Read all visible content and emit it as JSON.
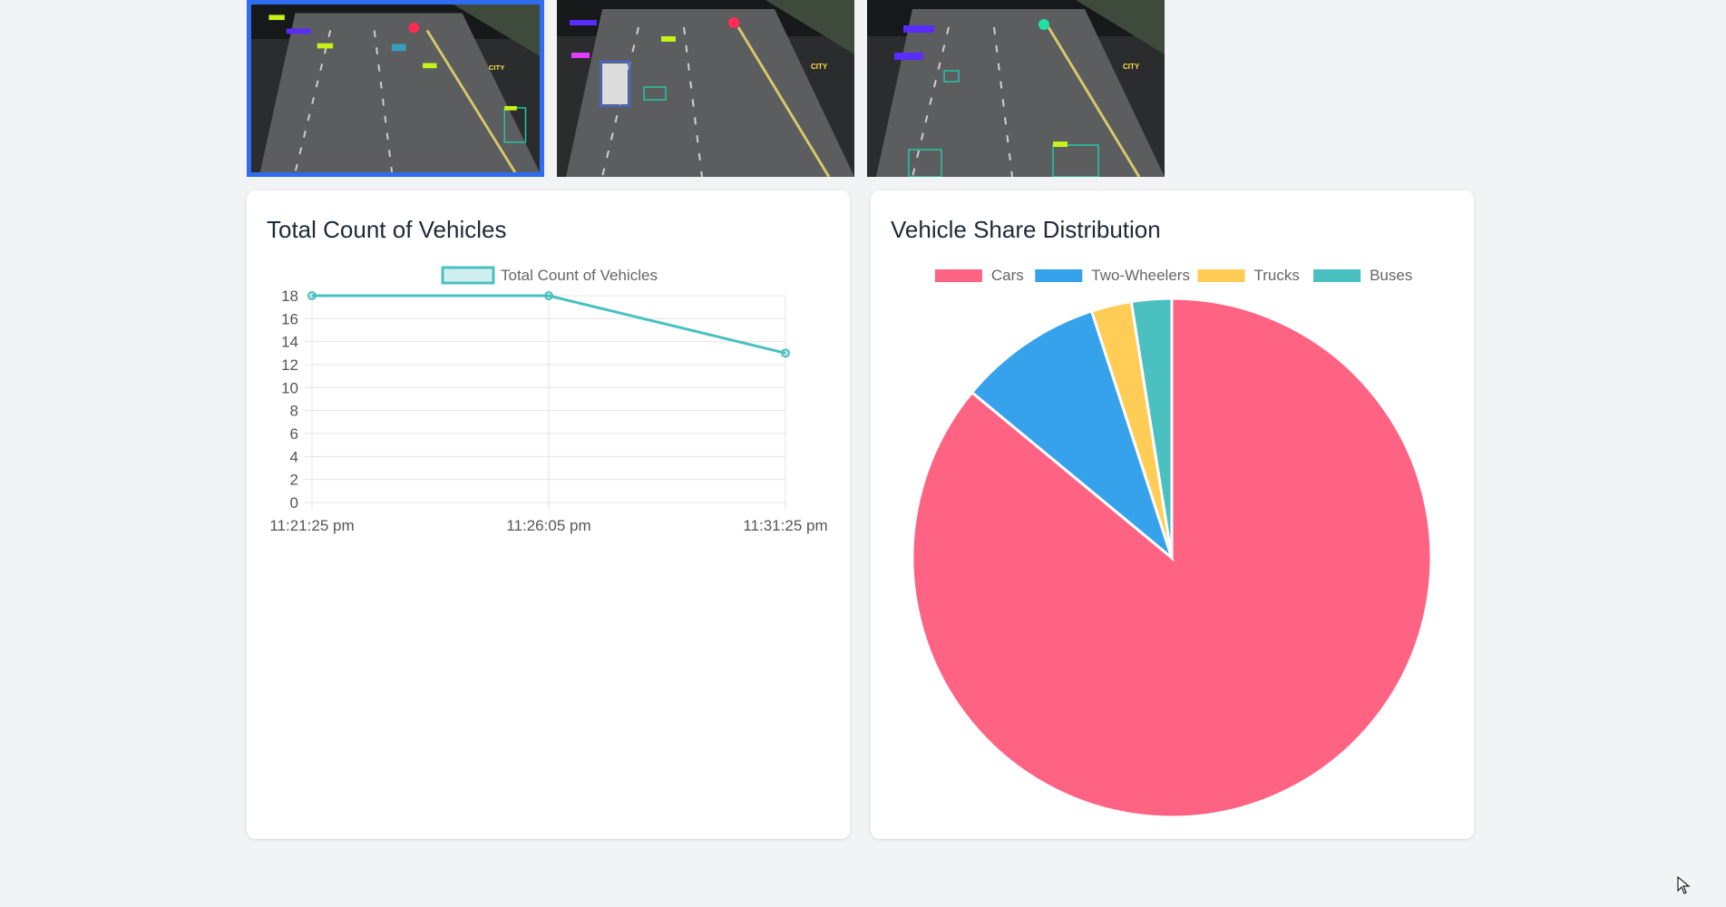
{
  "thumbnails": [
    {
      "label": "CITY",
      "active": true,
      "signal_color": "#ff2a55"
    },
    {
      "label": "CITY",
      "active": false,
      "signal_color": "#ff2a55"
    },
    {
      "label": "CITY",
      "active": false,
      "signal_color": "#1ee0a0"
    }
  ],
  "line_card": {
    "title": "Total Count of Vehicles"
  },
  "pie_card": {
    "title": "Vehicle Share Distribution"
  },
  "chart_data": [
    {
      "type": "line",
      "title": "Total Count of Vehicles",
      "x": [
        "11:21:25 pm",
        "11:26:05 pm",
        "11:31:25 pm"
      ],
      "series": [
        {
          "name": "Total Count of Vehicles",
          "values": [
            18,
            18,
            13
          ],
          "color": "#4bc0c0"
        }
      ],
      "yticks": [
        0,
        2,
        4,
        6,
        8,
        10,
        12,
        14,
        16,
        18
      ],
      "ylim": [
        0,
        18
      ],
      "grid": true,
      "legend": "top"
    },
    {
      "type": "pie",
      "title": "Vehicle Share Distribution",
      "categories": [
        "Cars",
        "Two-Wheelers",
        "Trucks",
        "Buses"
      ],
      "values": [
        86,
        9,
        2.5,
        2.5
      ],
      "colors": [
        "#ff6384",
        "#36a2eb",
        "#ffcd56",
        "#4bc0c0"
      ],
      "legend": "top"
    }
  ]
}
